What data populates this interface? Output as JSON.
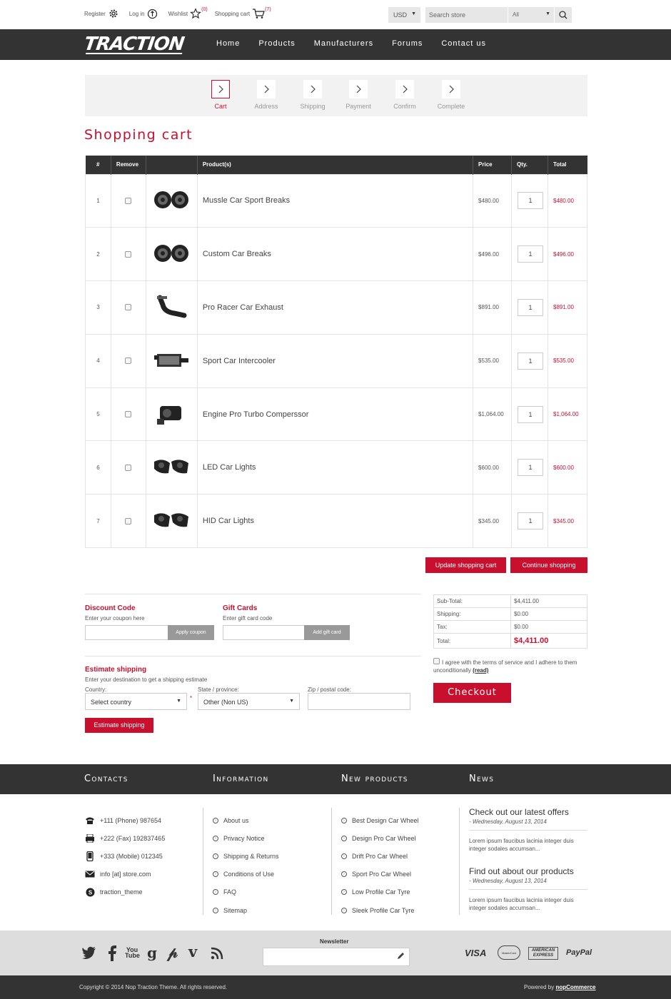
{
  "header": {
    "register": "Register",
    "login": "Log in",
    "wishlist": "Wishlist",
    "wishlist_count": "(0)",
    "cart": "Shopping cart",
    "cart_count": "(7)",
    "currency": "USD",
    "search_placeholder": "Search store",
    "category": "All"
  },
  "logo": "TRACTION",
  "nav": [
    "Home",
    "Products",
    "Manufacturers",
    "Forums",
    "Contact us"
  ],
  "steps": [
    "Cart",
    "Address",
    "Shipping",
    "Payment",
    "Confirm",
    "Complete"
  ],
  "page_title": "Shopping cart",
  "cart_table": {
    "headers": [
      "#",
      "Remove",
      "Product(s)",
      "Price",
      "Qty.",
      "Total"
    ],
    "rows": [
      {
        "n": "1",
        "name": "Mussle Car Sport Breaks",
        "price": "$480.00",
        "qty": "1",
        "total": "$480.00",
        "icon": "brake-icon"
      },
      {
        "n": "2",
        "name": "Custom Car Breaks",
        "price": "$496.00",
        "qty": "1",
        "total": "$496.00",
        "icon": "brake-icon"
      },
      {
        "n": "3",
        "name": "Pro Racer Car Exhaust",
        "price": "$891.00",
        "qty": "1",
        "total": "$891.00",
        "icon": "exhaust-icon"
      },
      {
        "n": "4",
        "name": "Sport Car Intercooler",
        "price": "$535.00",
        "qty": "1",
        "total": "$535.00",
        "icon": "intercooler-icon"
      },
      {
        "n": "5",
        "name": "Engine Pro Turbo Comperssor",
        "price": "$1,064.00",
        "qty": "1",
        "total": "$1,064.00",
        "icon": "turbo-icon"
      },
      {
        "n": "6",
        "name": "LED Car Lights",
        "price": "$600.00",
        "qty": "1",
        "total": "$600.00",
        "icon": "headlight-icon"
      },
      {
        "n": "7",
        "name": "HID Car Lights",
        "price": "$345.00",
        "qty": "1",
        "total": "$345.00",
        "icon": "headlight-icon"
      }
    ]
  },
  "buttons": {
    "update_cart": "Update shopping cart",
    "continue_shopping": "Continue shopping",
    "apply_coupon": "Apply coupon",
    "add_gift_card": "Add gift card",
    "estimate_shipping": "Estimate shipping",
    "checkout": "Checkout"
  },
  "discount": {
    "title": "Discount Code",
    "hint": "Enter your coupon here"
  },
  "gift": {
    "title": "Gift Cards",
    "hint": "Enter gift card code"
  },
  "shipping": {
    "title": "Estimate shipping",
    "hint": "Enter your destination to get a shipping estimate",
    "country_label": "Country:",
    "country_value": "Select country",
    "state_label": "State / province:",
    "state_value": "Other (Non US)",
    "zip_label": "Zip / postal code:",
    "required_mark": "*"
  },
  "totals": {
    "subtotal_label": "Sub-Total:",
    "subtotal": "$4,411.00",
    "shipping_label": "Shipping:",
    "shipping": "$0.00",
    "tax_label": "Tax:",
    "tax": "$0.00",
    "total_label": "Total:",
    "total": "$4,411.00"
  },
  "terms": {
    "text": "I agree with the terms of service and I adhere to them unconditionally",
    "link": "(read)"
  },
  "footer": {
    "headings": [
      "Contacts",
      "Information",
      "New products",
      "News"
    ],
    "contacts": [
      "+111 (Phone) 987654",
      "+222 (Fax) 192837465",
      "+333 (Mobile) 012345",
      "info [at] store.com",
      "traction_theme"
    ],
    "information": [
      "About us",
      "Privacy Notice",
      "Shipping & Returns",
      "Conditions of Use",
      "FAQ",
      "Sitemap"
    ],
    "new_products": [
      "Best Design Car Wheel",
      "Design Pro Car Wheel",
      "Drift Pro Car Wheel",
      "Sport Pro Car Wheel",
      "Low Profile Car Tyre",
      "Sleek Profile Car Tyre"
    ],
    "news": [
      {
        "title": "Check out our latest offers",
        "date": "- Wednesday, August 13, 2014",
        "text": "Lorem ipsum faucibus lacinia integer duis integer sodales accumsan..."
      },
      {
        "title": "Find out about our products",
        "date": "- Wednesday, August 13, 2014",
        "text": "Lorem ipsum faucibus lacinia integer duis integer sodales accumsan..."
      }
    ],
    "newsletter": "Newsletter",
    "social_youtube": "You Tube",
    "payments": [
      "VISA",
      "MasterCard",
      "AMERICAN EXPRESS",
      "PayPal"
    ],
    "copyright": "Copyright © 2014 Nop Traction Theme. All rights reserved.",
    "powered_by": "Powered by",
    "powered_link": "nopCommerce"
  }
}
